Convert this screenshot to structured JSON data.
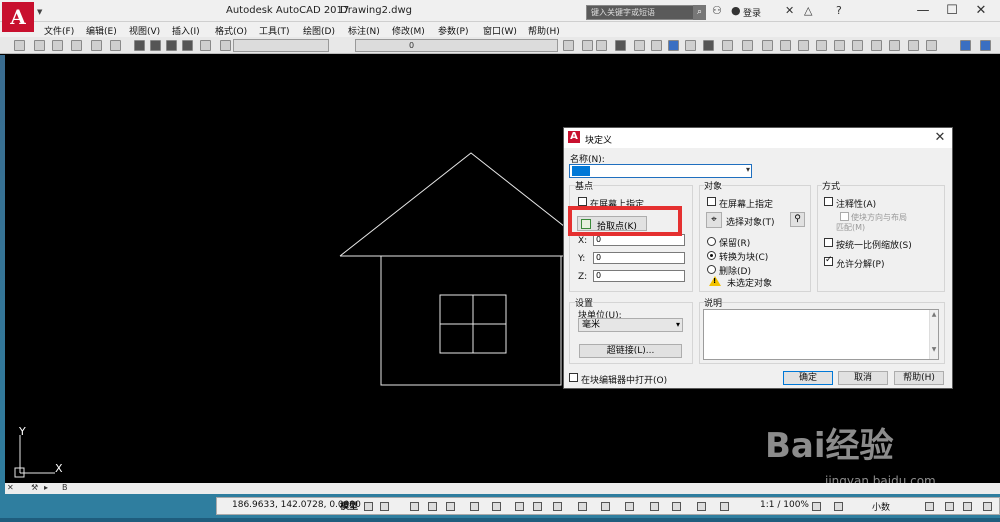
{
  "app": {
    "title": "Autodesk AutoCAD 2017",
    "document": "Drawing2.dwg",
    "logo_letter": "A",
    "search_placeholder": "键入关键字或短语",
    "login": "登录"
  },
  "menu": [
    "文件(F)",
    "编辑(E)",
    "视图(V)",
    "插入(I)",
    "格式(O)",
    "工具(T)",
    "绘图(D)",
    "标注(N)",
    "修改(M)",
    "参数(P)",
    "窗口(W)",
    "帮助(H)"
  ],
  "toolbar": {
    "layer_value": "0",
    "colors": {
      "accent": "#c8102e",
      "status_bg": "#2f7e9f",
      "highlight": "#e53030"
    }
  },
  "dialog": {
    "title": "块定义",
    "name_label": "名称(N):",
    "base_point": {
      "group": "基点",
      "specify_on_screen": "在屏幕上指定",
      "pick_point": "拾取点(K)",
      "x_label": "X:",
      "y_label": "Y:",
      "z_label": "Z:",
      "x": "0",
      "y": "0",
      "z": "0"
    },
    "objects": {
      "group": "对象",
      "specify_on_screen": "在屏幕上指定",
      "select_objects": "选择对象(T)",
      "retain": "保留(R)",
      "convert_to_block": "转换为块(C)",
      "delete": "删除(D)",
      "no_selection": "未选定对象"
    },
    "behavior": {
      "group": "方式",
      "annotative": "注释性(A)",
      "match_orientation_line1": "使块方向与布局",
      "match_orientation_line2": "匹配(M)",
      "scale_uniformly": "按统一比例缩放(S)",
      "allow_exploding": "允许分解(P)"
    },
    "settings": {
      "group": "设置",
      "block_unit_label": "块单位(U):",
      "block_unit": "毫米",
      "hyperlink": "超链接(L)..."
    },
    "description": {
      "group": "说明"
    },
    "open_in_editor": "在块编辑器中打开(O)",
    "ok": "确定",
    "cancel": "取消",
    "help": "帮助(H)"
  },
  "ucs": {
    "x": "X",
    "y": "Y"
  },
  "command": {
    "prompt": "B"
  },
  "status": {
    "coordinates": "186.9633, 142.0728, 0.0000",
    "model": "模型",
    "scale": "1:1 / 100%",
    "units": "小数"
  },
  "watermark": {
    "brand": "Bai经验",
    "url": "jingyan.baidu.com"
  }
}
